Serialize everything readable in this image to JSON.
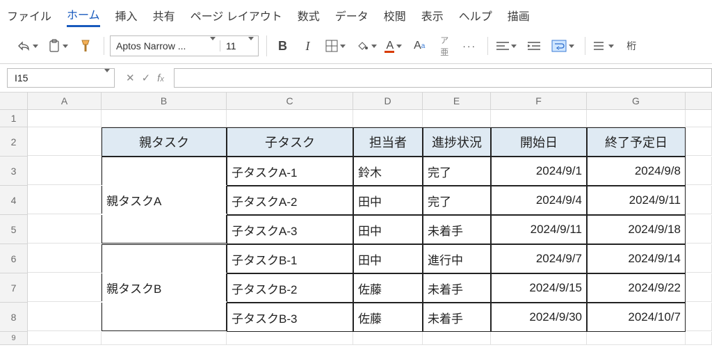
{
  "menu": {
    "items": [
      "ファイル",
      "ホーム",
      "挿入",
      "共有",
      "ページ レイアウト",
      "数式",
      "データ",
      "校閲",
      "表示",
      "ヘルプ",
      "描画"
    ],
    "active_index": 1
  },
  "ribbon": {
    "font_name": "Aptos Narrow ...",
    "font_size": "11"
  },
  "namebox": "I15",
  "cols": [
    "A",
    "B",
    "C",
    "D",
    "E",
    "F",
    "G"
  ],
  "rows": [
    "1",
    "2",
    "3",
    "4",
    "5",
    "6",
    "7",
    "8",
    "9"
  ],
  "table": {
    "headers": {
      "parent": "親タスク",
      "child": "子タスク",
      "assignee": "担当者",
      "status": "進捗状況",
      "start": "開始日",
      "end": "終了予定日"
    },
    "groups": [
      {
        "parent": "親タスクA",
        "rows": [
          {
            "child": "子タスクA-1",
            "assignee": "鈴木",
            "status": "完了",
            "start": "2024/9/1",
            "end": "2024/9/8"
          },
          {
            "child": "子タスクA-2",
            "assignee": "田中",
            "status": "完了",
            "start": "2024/9/4",
            "end": "2024/9/11"
          },
          {
            "child": "子タスクA-3",
            "assignee": "田中",
            "status": "未着手",
            "start": "2024/9/11",
            "end": "2024/9/18"
          }
        ]
      },
      {
        "parent": "親タスクB",
        "rows": [
          {
            "child": "子タスクB-1",
            "assignee": "田中",
            "status": "進行中",
            "start": "2024/9/7",
            "end": "2024/9/14"
          },
          {
            "child": "子タスクB-2",
            "assignee": "佐藤",
            "status": "未着手",
            "start": "2024/9/15",
            "end": "2024/9/22"
          },
          {
            "child": "子タスクB-3",
            "assignee": "佐藤",
            "status": "未着手",
            "start": "2024/9/30",
            "end": "2024/10/7"
          }
        ]
      }
    ]
  }
}
